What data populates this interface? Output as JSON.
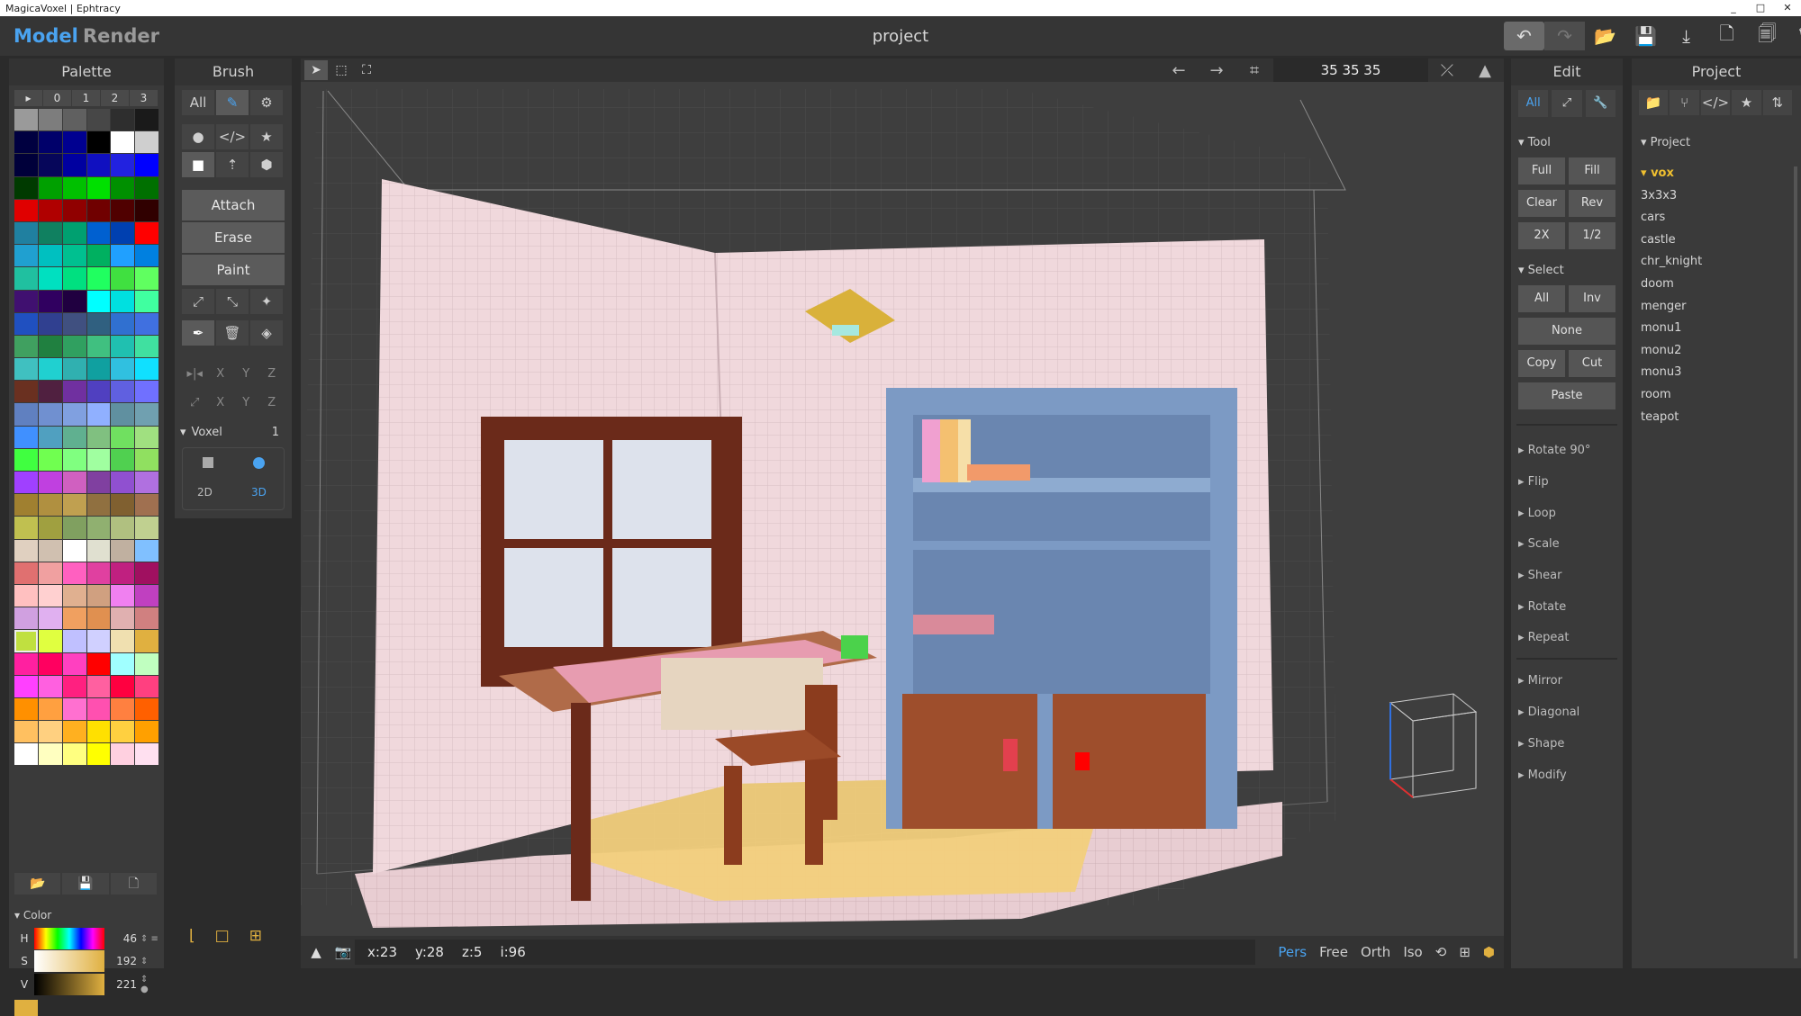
{
  "window": {
    "title": "MagicaVoxel | Ephtracy",
    "controls": [
      "_",
      "□",
      "✕"
    ]
  },
  "topbar": {
    "mode_model": "Model",
    "mode_render": "Render",
    "project_title": "project",
    "icons": [
      "↶",
      "↷",
      "📂",
      "💾",
      "⤓",
      "🗋",
      "🗐",
      "🗑"
    ]
  },
  "palette": {
    "header": "Palette",
    "tabs": [
      "▸",
      "0",
      "1",
      "2",
      "3"
    ],
    "colors": [
      "#9a9a9a",
      "#7d7d7d",
      "#606060",
      "#474747",
      "#2e2e2e",
      "#1a1a1a",
      "#000040",
      "#00006a",
      "#000090",
      "#000000",
      "#ffffff",
      "#cfcfcf",
      "#00003a",
      "#06065a",
      "#0000a0",
      "#1010c0",
      "#2222e0",
      "#0000ff",
      "#003a00",
      "#00a000",
      "#00c000",
      "#00e000",
      "#009000",
      "#007000",
      "#e00000",
      "#b00000",
      "#900000",
      "#700000",
      "#500000",
      "#300000",
      "#2080a0",
      "#108060",
      "#00a070",
      "#0060d0",
      "#0040b0",
      "#ff0000",
      "#20a0d0",
      "#00c0c0",
      "#00c090",
      "#00b060",
      "#20a0ff",
      "#0080e0",
      "#20c0a0",
      "#00e0c0",
      "#00e080",
      "#20ff60",
      "#40e040",
      "#60ff60",
      "#401070",
      "#300060",
      "#200040",
      "#00ffff",
      "#00e0e0",
      "#40ffa0",
      "#2050c0",
      "#304090",
      "#405080",
      "#306080",
      "#3070d0",
      "#4070e0",
      "#40a060",
      "#208040",
      "#30a060",
      "#40c080",
      "#20c0b0",
      "#40e0a0",
      "#40c0c0",
      "#20d0d0",
      "#30b0b0",
      "#10a0a0",
      "#30c0e0",
      "#10e0ff",
      "#6a3020",
      "#502040",
      "#7030a0",
      "#5040c0",
      "#6060e0",
      "#7070ff",
      "#6080c0",
      "#7090d0",
      "#80a0e0",
      "#90b0ff",
      "#6090a0",
      "#70a0b0",
      "#4090ff",
      "#50a0c0",
      "#60b090",
      "#80c080",
      "#70e060",
      "#a0e080",
      "#40ff40",
      "#70ff50",
      "#80ff80",
      "#a0ffa0",
      "#50d050",
      "#90e060",
      "#a040ff",
      "#c040e0",
      "#d060c0",
      "#8040a0",
      "#9050d0",
      "#b070e0",
      "#a08030",
      "#b09040",
      "#c0a050",
      "#907040",
      "#806030",
      "#a07050",
      "#c0c050",
      "#a0a040",
      "#80a060",
      "#90b070",
      "#b0c080",
      "#c0d090",
      "#e0d0c0",
      "#d0c0b0",
      "#ffffff",
      "#e0e0d0",
      "#c0b0a0",
      "#80c0ff",
      "#e07070",
      "#f0a0a0",
      "#ff60c0",
      "#e040a0",
      "#c02080",
      "#a01060",
      "#ffc0c0",
      "#ffd0d0",
      "#e0b090",
      "#d0a080",
      "#f080f0",
      "#c040c0",
      "#d0a0e0",
      "#e0b0f0",
      "#f0a060",
      "#e09050",
      "#e0b0b0",
      "#d08080",
      "#c0e040",
      "#e0ff40",
      "#c0c0ff",
      "#d0d0ff",
      "#f0e0b0",
      "#e0b040",
      "#ff20a0",
      "#ff0060",
      "#ff40c0",
      "#ff0000",
      "#a0ffff",
      "#c0ffc0",
      "#ff40ff",
      "#ff60e0",
      "#ff2080",
      "#ff60a0",
      "#ff0040",
      "#ff4080",
      "#ff9000",
      "#ffa040",
      "#ff70d0",
      "#ff50b0",
      "#ff8040",
      "#ff6000",
      "#ffc060",
      "#ffd080",
      "#ffb020",
      "#ffe000",
      "#ffd040",
      "#ffa000",
      "#ffffff",
      "#ffffc0",
      "#ffff80",
      "#ffff00",
      "#ffd0e0",
      "#ffe0f0"
    ],
    "selected_index": 138,
    "bottom_icons": [
      "📂",
      "💾",
      "🗋"
    ],
    "color_section": "Color",
    "hsv": [
      {
        "label": "H",
        "value": "46"
      },
      {
        "label": "S",
        "value": "192"
      },
      {
        "label": "V",
        "value": "221"
      }
    ]
  },
  "brush": {
    "header": "Brush",
    "row1": [
      "All",
      "✎",
      "⚙"
    ],
    "row2": [
      "●",
      "</>",
      "★"
    ],
    "row3": [
      "■",
      "⇡",
      "⬢"
    ],
    "actions": [
      "Attach",
      "Erase",
      "Paint"
    ],
    "row4": [
      "⤢",
      "⤡",
      "✦"
    ],
    "row5": [
      "✒",
      "🗑",
      "◈"
    ],
    "axes1": [
      "▸|◂",
      "X",
      "Y",
      "Z"
    ],
    "axes2": [
      "⤢",
      "X",
      "Y",
      "Z"
    ],
    "voxel_label": "Voxel",
    "voxel_value": "1",
    "dim2": "2D",
    "dim3": "3D"
  },
  "viewport": {
    "tools": [
      "➤",
      "⬚",
      "⛶"
    ],
    "arrows": [
      "←",
      "→"
    ],
    "crop_icon": "⌗",
    "dims": "35  35  35",
    "right_icons": [
      "⤫",
      "▲"
    ],
    "coords": {
      "x": "x:23",
      "y": "y:28",
      "z": "z:5",
      "i": "i:96"
    },
    "bottom_left": [
      "▲",
      "📷"
    ],
    "views": [
      "Pers",
      "Free",
      "Orth",
      "Iso"
    ],
    "view_active": "Pers",
    "view_icons": [
      "⟲",
      "⊞",
      "⬢"
    ]
  },
  "edit": {
    "header": "Edit",
    "tabs": [
      "All",
      "⤢",
      "🔧"
    ],
    "tool_section": "Tool",
    "tool_rows": [
      [
        "Full",
        "Fill"
      ],
      [
        "Clear",
        "Rev"
      ],
      [
        "2X",
        "1/2"
      ]
    ],
    "select_section": "Select",
    "select_rows": [
      [
        "All",
        "Inv"
      ],
      [
        "None"
      ],
      [
        "Copy",
        "Cut"
      ],
      [
        "Paste"
      ]
    ],
    "transforms": [
      "Rotate 90°",
      "Flip",
      "Loop",
      "Scale",
      "Shear",
      "Rotate",
      "Repeat"
    ],
    "generators": [
      "Mirror",
      "Diagonal",
      "Shape",
      "Modify"
    ]
  },
  "project": {
    "header": "Project",
    "icons": [
      "📁",
      "⑂",
      "</>",
      "★",
      "⇅"
    ],
    "section": "Project",
    "items": [
      "vox",
      "3x3x3",
      "cars",
      "castle",
      "chr_knight",
      "doom",
      "menger",
      "monu1",
      "monu2",
      "monu3",
      "room",
      "teapot"
    ],
    "current": "vox"
  }
}
